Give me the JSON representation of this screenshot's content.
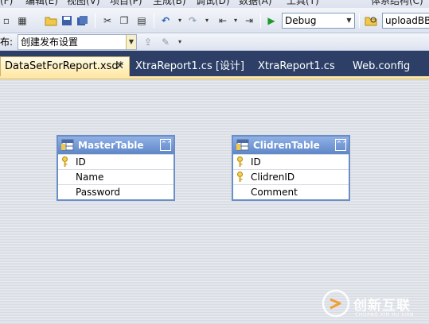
{
  "menu": {
    "items": [
      "(F)",
      "编辑(E)",
      "视图(V)",
      "项目(P)",
      "生成(B)",
      "调试(D)",
      "数据(A)",
      "工具(T)",
      "体系结构(C)"
    ]
  },
  "toolbar": {
    "config_combo": "Debug",
    "platform_combo": "uploadBB",
    "publish_label": "布:",
    "publish_combo": "创建发布设置"
  },
  "tabs": [
    {
      "label": "DataSetForReport.xsd*",
      "active": true,
      "close": "✕"
    },
    {
      "label": "XtraReport1.cs [设计]",
      "active": false
    },
    {
      "label": "XtraReport1.cs",
      "active": false
    },
    {
      "label": "Web.config",
      "active": false
    }
  ],
  "designer": {
    "tables": [
      {
        "name": "MasterTable",
        "fields": [
          {
            "name": "ID",
            "key": true
          },
          {
            "name": "Name",
            "key": false
          },
          {
            "name": "Password",
            "key": false
          }
        ]
      },
      {
        "name": "ClidrenTable",
        "fields": [
          {
            "name": "ID",
            "key": true
          },
          {
            "name": "ClidrenID",
            "key": true
          },
          {
            "name": "Comment",
            "key": false
          }
        ]
      }
    ]
  },
  "watermark": {
    "brand": "创新互联",
    "sub": "CHUANG XIN HU LIAN"
  },
  "colors": {
    "tab_strip": "#2d3f66",
    "active_tab": "#ffe8a6",
    "table_header": "#5f86c7",
    "table_border": "#6b8ec6"
  }
}
